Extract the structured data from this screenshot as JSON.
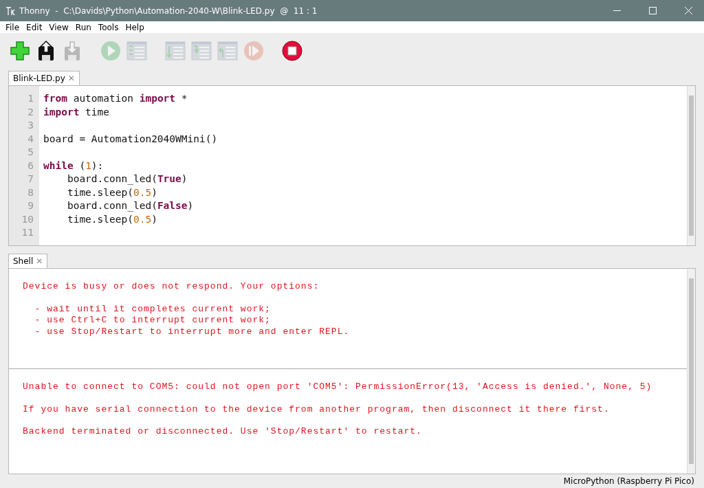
{
  "window": {
    "title": "Thonny  -  C:\\Davids\\Python\\Automation-2040-W\\Blink-LED.py  @  11 : 1"
  },
  "menu": [
    "File",
    "Edit",
    "View",
    "Run",
    "Tools",
    "Help"
  ],
  "toolbar": [
    {
      "kind": "new",
      "disabled": false
    },
    {
      "kind": "load",
      "disabled": false
    },
    {
      "kind": "save",
      "disabled": true
    },
    {
      "kind": "run",
      "disabled": true
    },
    {
      "kind": "debug",
      "disabled": true
    },
    {
      "kind": "step_over",
      "disabled": true
    },
    {
      "kind": "step_into",
      "disabled": true
    },
    {
      "kind": "step_out",
      "disabled": true
    },
    {
      "kind": "resume",
      "disabled": true
    },
    {
      "kind": "stop",
      "disabled": false
    }
  ],
  "editor": {
    "tabs": [
      {
        "label": "Blink-LED.py",
        "close": "✕",
        "selected": true
      }
    ],
    "lines": [
      {
        "number": "1",
        "tokens": [
          {
            "text": "from",
            "kind": "kw"
          },
          {
            "text": " automation ",
            "kind": "plain"
          },
          {
            "text": "import",
            "kind": "kw"
          },
          {
            "text": " *",
            "kind": "plain"
          }
        ]
      },
      {
        "number": "2",
        "tokens": [
          {
            "text": "import",
            "kind": "kw"
          },
          {
            "text": " time",
            "kind": "plain"
          }
        ]
      },
      {
        "number": "3"
      },
      {
        "number": "4",
        "tokens": [
          {
            "text": "board = Automation2040WMini()",
            "kind": "plain"
          }
        ]
      },
      {
        "number": "5"
      },
      {
        "number": "6",
        "tokens": [
          {
            "text": "while",
            "kind": "kw"
          },
          {
            "text": " (",
            "kind": "plain"
          },
          {
            "text": "1",
            "kind": "num"
          },
          {
            "text": "):",
            "kind": "plain"
          }
        ]
      },
      {
        "number": "7",
        "tokens": [
          {
            "text": "    board.conn_led(",
            "kind": "plain"
          },
          {
            "text": "True",
            "kind": "kw"
          },
          {
            "text": ")",
            "kind": "plain"
          }
        ]
      },
      {
        "number": "8",
        "tokens": [
          {
            "text": "    time.sleep(",
            "kind": "plain"
          },
          {
            "text": "0.5",
            "kind": "num"
          },
          {
            "text": ")",
            "kind": "plain"
          }
        ]
      },
      {
        "number": "9",
        "tokens": [
          {
            "text": "    board.conn_led(",
            "kind": "plain"
          },
          {
            "text": "False",
            "kind": "kw"
          },
          {
            "text": ")",
            "kind": "plain"
          }
        ]
      },
      {
        "number": "10",
        "tokens": [
          {
            "text": "    time.sleep(",
            "kind": "plain"
          },
          {
            "text": "0.5",
            "kind": "num"
          },
          {
            "text": ")",
            "kind": "plain"
          }
        ]
      },
      {
        "number": "11"
      }
    ]
  },
  "shell": {
    "tabs": [
      {
        "label": "Shell",
        "close": "✕",
        "selected": true
      }
    ],
    "sections": [
      {
        "paragraphs": [
          [
            "Device is busy or does not respond. Your options:"
          ],
          [
            "  - wait until it completes current work;",
            "  - use Ctrl+C to interrupt current work;",
            "  - use Stop/Restart to interrupt more and enter REPL."
          ]
        ]
      },
      {
        "paragraphs": [
          [
            "Unable to connect to COM5: could not open port 'COM5': PermissionError(13, 'Access is denied.', None, 5)"
          ],
          [
            "If you have serial connection to the device from another program, then disconnect it there first."
          ],
          [
            "Backend terminated or disconnected. Use 'Stop/Restart' to restart."
          ]
        ]
      }
    ]
  },
  "status_bar": {
    "interpreter": "MicroPython (Raspberry Pi Pico)"
  }
}
